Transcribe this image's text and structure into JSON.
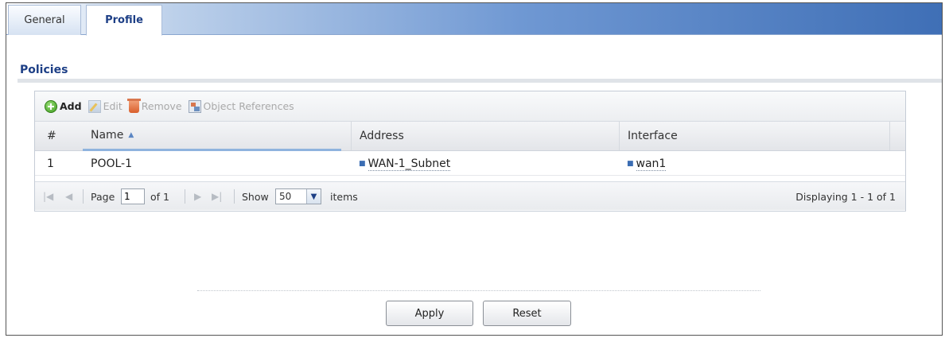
{
  "tabs": [
    {
      "label": "General",
      "active": false
    },
    {
      "label": "Profile",
      "active": true
    }
  ],
  "section": {
    "title": "Policies"
  },
  "toolbar": {
    "add_label": "Add",
    "edit_label": "Edit",
    "remove_label": "Remove",
    "object_references_label": "Object References"
  },
  "table": {
    "columns": [
      "#",
      "Name",
      "Address",
      "Interface"
    ],
    "sorted_column": "Name",
    "sort_direction": "ascending",
    "rows": [
      {
        "num": "1",
        "name": "POOL-1",
        "address": "WAN-1_Subnet",
        "interface": "wan1"
      }
    ]
  },
  "pager": {
    "page_label": "Page",
    "page_value": "1",
    "of_label": "of 1",
    "show_label": "Show",
    "page_size": "50",
    "items_label": "items",
    "displaying": "Displaying 1 - 1 of 1"
  },
  "buttons": {
    "apply": "Apply",
    "reset": "Reset"
  },
  "colors": {
    "accent": "#1d3f86",
    "tab_gradient_end": "#3f6fb6"
  },
  "icons": {
    "add": "add-circle-icon",
    "edit": "edit-icon",
    "remove": "trash-icon",
    "object_references": "object-references-icon",
    "first": "first-page-icon",
    "prev": "prev-page-icon",
    "next": "next-page-icon",
    "last": "last-page-icon"
  }
}
